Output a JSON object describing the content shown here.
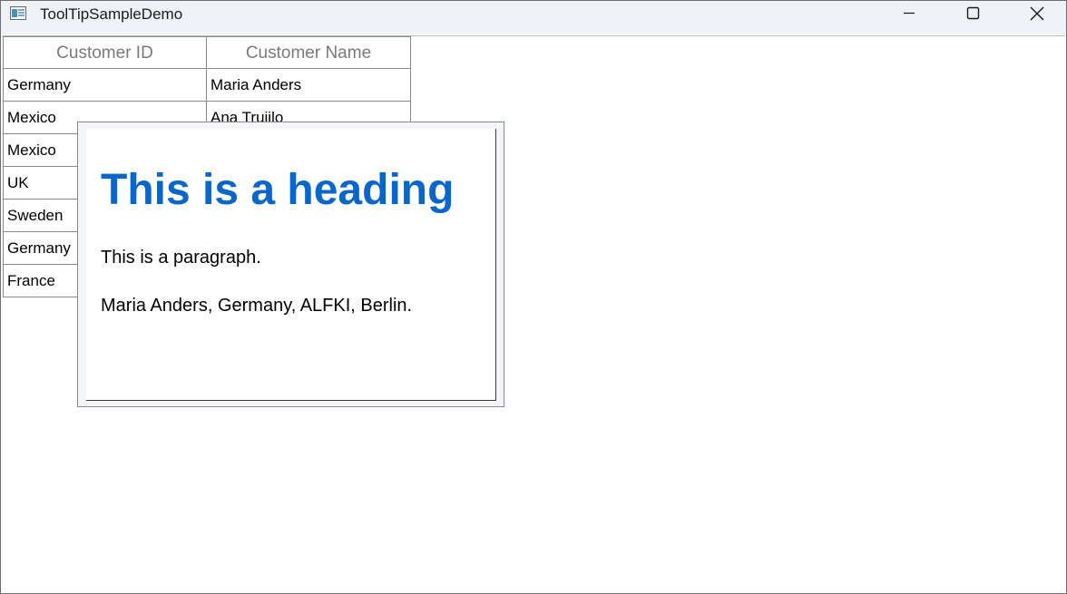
{
  "window": {
    "title": "ToolTipSampleDemo"
  },
  "grid": {
    "columns": [
      "Customer ID",
      "Customer Name"
    ],
    "rows": [
      [
        "Germany",
        "Maria Anders"
      ],
      [
        "Mexico",
        "Ana Trujilo"
      ],
      [
        "Mexico",
        ""
      ],
      [
        "UK",
        ""
      ],
      [
        "Sweden",
        ""
      ],
      [
        "Germany",
        ""
      ],
      [
        "France",
        ""
      ]
    ]
  },
  "tooltip": {
    "heading": "This is a heading",
    "paragraph": "This is a paragraph.",
    "details": "Maria Anders, Germany, ALFKI, Berlin.",
    "heading_color": "#0a66c8"
  },
  "icons": {
    "app": "app-window-icon",
    "minimize": "minimize-icon",
    "maximize": "maximize-icon",
    "close": "close-icon"
  }
}
